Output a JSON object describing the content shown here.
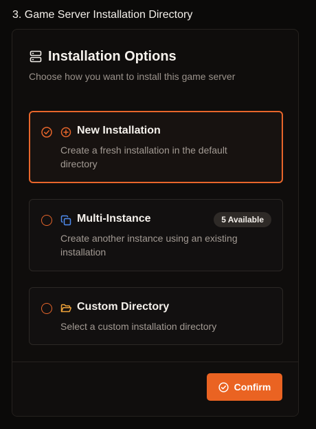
{
  "step": {
    "title": "3. Game Server Installation Directory"
  },
  "panel": {
    "title": "Installation Options",
    "title_icon": "server-icon",
    "subtitle": "Choose how you want to install this game server"
  },
  "options": [
    {
      "title": "New Installation",
      "description": "Create a fresh installation in the default directory",
      "icon": "plus-circle-icon",
      "selected": true
    },
    {
      "title": "Multi-Instance",
      "description": "Create another instance using an existing installation",
      "icon": "copy-icon",
      "badge": "5 Available",
      "selected": false
    },
    {
      "title": "Custom Directory",
      "description": "Select a custom installation directory",
      "icon": "folder-open-icon",
      "selected": false
    }
  ],
  "footer": {
    "confirm_label": "Confirm",
    "confirm_icon": "check-circle-icon"
  },
  "colors": {
    "accent": "#ea6322",
    "background": "#0b0a09",
    "panel": "#0f0d0c",
    "text_muted": "#a39b94",
    "multi_instance_icon": "#4f8cf0",
    "folder_icon": "#f0a43a"
  }
}
